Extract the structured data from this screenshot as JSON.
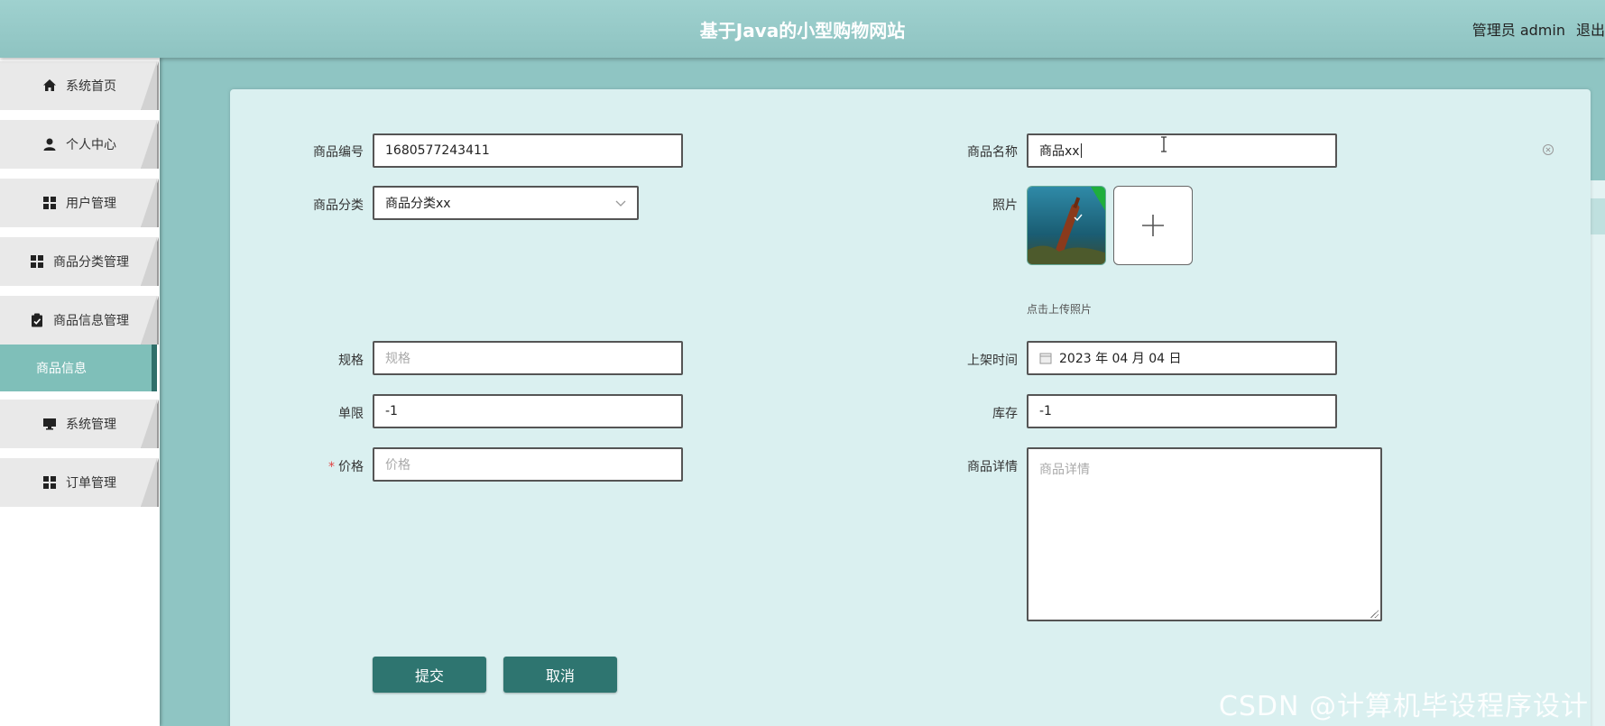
{
  "header": {
    "title": "基于Java的小型购物网站",
    "user_label": "管理员 admin",
    "logout_label": "退出"
  },
  "sidebar": {
    "items": [
      {
        "label": "系统首页",
        "icon": "home-icon"
      },
      {
        "label": "个人中心",
        "icon": "user-icon"
      },
      {
        "label": "用户管理",
        "icon": "grid-icon"
      },
      {
        "label": "商品分类管理",
        "icon": "grid-icon"
      },
      {
        "label": "商品信息管理",
        "icon": "clipboard-icon"
      },
      {
        "label": "系统管理",
        "icon": "monitor-icon"
      },
      {
        "label": "订单管理",
        "icon": "grid-icon"
      }
    ],
    "active_sub_item": "商品信息"
  },
  "form": {
    "product_code": {
      "label": "商品编号",
      "value": "1680577243411"
    },
    "product_name": {
      "label": "商品名称",
      "value": "商品xx"
    },
    "category": {
      "label": "商品分类",
      "value": "商品分类xx"
    },
    "photo": {
      "label": "照片",
      "hint": "点击上传照片"
    },
    "spec": {
      "label": "规格",
      "placeholder": "规格"
    },
    "listing_time": {
      "label": "上架时间",
      "value": "2023 年 04 月 04 日"
    },
    "limit": {
      "label": "单限",
      "value": "-1"
    },
    "stock": {
      "label": "库存",
      "value": "-1"
    },
    "price": {
      "label": "价格",
      "required_mark": "*",
      "placeholder": "价格"
    },
    "details": {
      "label": "商品详情",
      "placeholder": "商品详情"
    }
  },
  "buttons": {
    "submit": "提交",
    "cancel": "取消"
  },
  "watermark": "CSDN @计算机毕设程序设计",
  "colors": {
    "header_bg": "#9fd1cf",
    "page_bg": "#8fc5c3",
    "panel_bg": "#daf0f0",
    "button_bg": "#2e7570",
    "active_sub_bg": "#7fbfb9"
  }
}
